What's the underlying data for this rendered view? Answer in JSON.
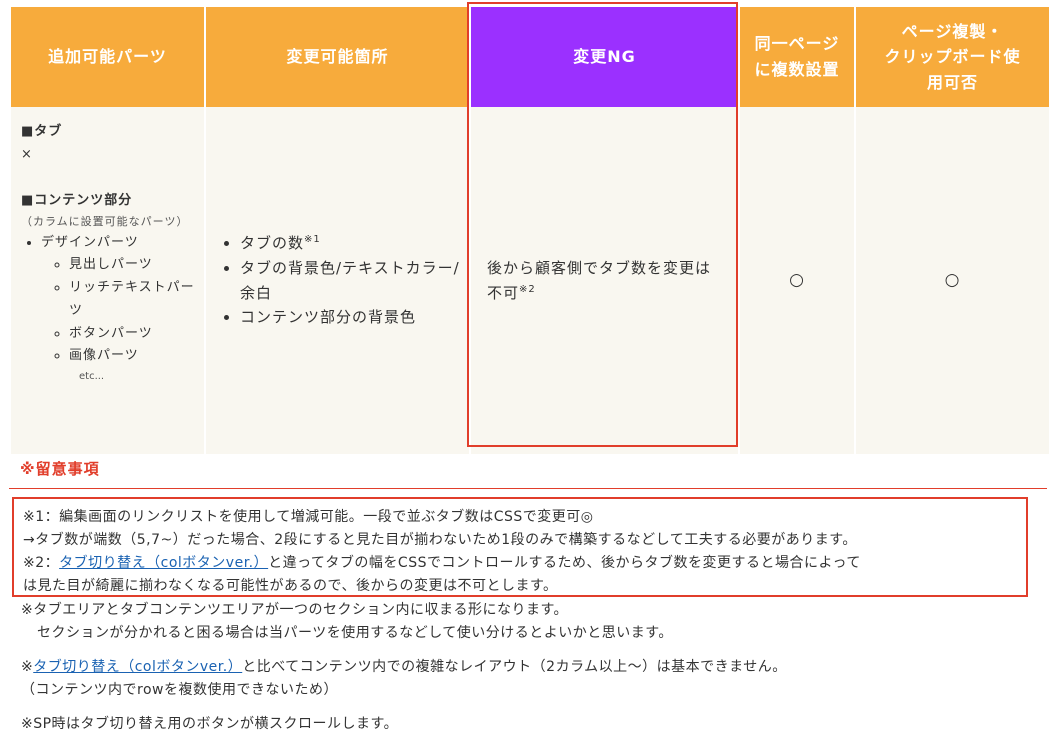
{
  "table": {
    "headers": {
      "c0": "追加可能パーツ",
      "c1": "変更可能箇所",
      "c2": "変更NG",
      "c3_lines": [
        "同一ページ",
        "に複数設置"
      ],
      "c4_lines": [
        "ページ複製・",
        "クリップボード使",
        "用可否"
      ]
    },
    "col0": {
      "tab_heading": "■タブ",
      "tab_value": "×",
      "content_heading": "■コンテンツ部分",
      "content_note": "（カラムに設置可能なパーツ）",
      "design_parts": "デザインパーツ",
      "sub_items": [
        "見出しパーツ",
        "リッチテキストパーツ",
        "ボタンパーツ",
        "画像パーツ"
      ],
      "etc": "etc..."
    },
    "col1": {
      "items": [
        {
          "text": "タブの数",
          "sup": "※1"
        },
        {
          "text": "タブの背景色/テキストカラー/余白",
          "sup": ""
        },
        {
          "text": "コンテンツ部分の背景色",
          "sup": ""
        }
      ]
    },
    "col2": {
      "text": "後から顧客側でタブ数を変更は不可",
      "sup": "※2"
    },
    "col3": "○",
    "col4": "○"
  },
  "notes": {
    "title": "※留意事項",
    "boxed": {
      "l1": "※1：編集画面のリンクリストを使用して増減可能。一段で並ぶタブ数はCSSで変更可◎",
      "l2": "→タブ数が端数（5,7~）だった場合、2段にすると見た目が揃わないため1段のみで構築するなどして工夫する必要があります。",
      "l3_pre": "※2：",
      "l3_link": "タブ切り替え（colボタンver.）",
      "l3_post": "と違ってタブの幅をCSSでコントロールするため、後からタブ数を変更すると場合によって",
      "l4": "は見た目が綺麗に揃わなくなる可能性があるので、後からの変更は不可とします。"
    },
    "extra": {
      "e1": "※タブエリアとタブコンテンツエリアが一つのセクション内に収まる形になります。",
      "e2": "セクションが分かれると困る場合は当パーツを使用するなどして使い分けるとよいかと思います。",
      "e3_pre": "※",
      "e3_link": "タブ切り替え（colボタンver.）",
      "e3_post": "と比べてコンテンツ内での複雑なレイアウト（2カラム以上〜）は基本できません。",
      "e4": "（コンテンツ内でrowを複数使用できないため）",
      "e5": "※SP時はタブ切り替え用のボタンが横スクロールします。"
    }
  },
  "colors": {
    "header_orange": "#f7ab3c",
    "header_purple": "#9b30ff",
    "cell_bg": "#f9f7f0",
    "highlight_red": "#e13e2b",
    "link_blue": "#1a62b2"
  }
}
